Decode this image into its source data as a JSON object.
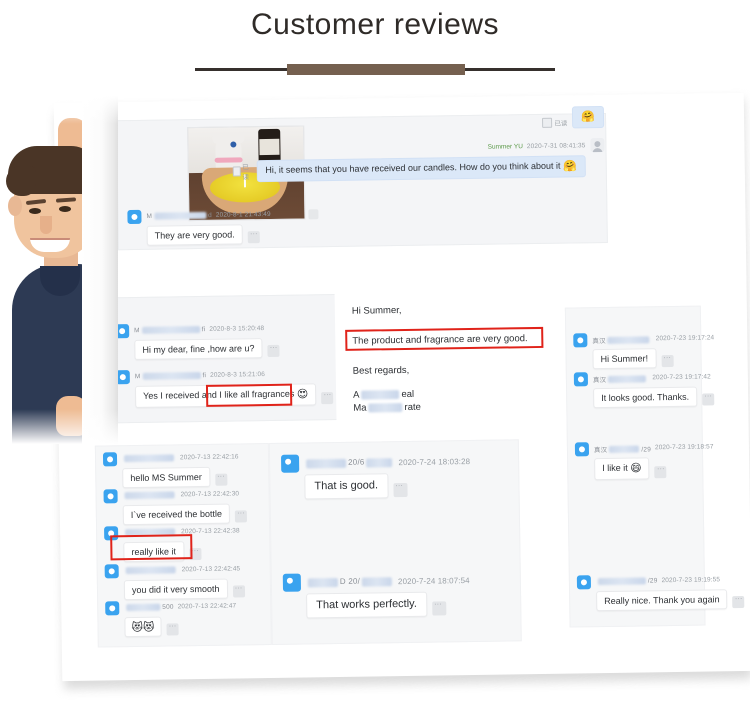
{
  "header": {
    "title": "Customer reviews",
    "rule_dark_color": "#36302d",
    "rule_brown_color": "#75604f"
  },
  "decor": {
    "man_photo_alt": "smiling man peeking around a white board",
    "card_background": "#ffffff",
    "panel_background": "#f4f5f7"
  },
  "panels": [
    {
      "id": "panel-top-left",
      "photo": {
        "alt": "yellow candle in a wooden bowl on a dark wood table"
      },
      "read_label": "已读",
      "messages": [
        {
          "side": "out",
          "nick": "Summer YU",
          "time": "2020-7-31 08:41:35",
          "text": "Hi, it seems that you have received our candles. How do you think about it",
          "emoji": "🤗",
          "read_label": "已读"
        },
        {
          "side": "in",
          "nick_prefix": "M",
          "nick_suffix": "d",
          "time": "2020-8-1 21:43:49",
          "text": "They are very good."
        }
      ]
    },
    {
      "id": "panel-mid-left",
      "messages": [
        {
          "side": "in",
          "nick_prefix": "M",
          "nick_suffix": "fi",
          "time": "2020-8-3 15:20:48",
          "text": "Hi my dear, fine ,how are u?"
        },
        {
          "side": "in",
          "nick_prefix": "M",
          "nick_suffix": "fi",
          "time": "2020-8-3 15:21:06",
          "text_before": "Yes I received and ",
          "text_highlight": "I like all fragrances",
          "emoji": "😍",
          "highlighted": true
        }
      ]
    },
    {
      "id": "panel-email",
      "lines": [
        "Hi Summer,",
        "The product and fragrance are very good.",
        "Best regards,",
        "A          eal",
        "Ma        rate"
      ],
      "highlight_line_index": 1
    },
    {
      "id": "panel-right-top",
      "messages": [
        {
          "side": "in",
          "nick_prefix": "真汉",
          "time": "2020-7-23 19:17:24",
          "text": "Hi Summer!"
        },
        {
          "side": "in",
          "nick_prefix": "真汉",
          "time": "2020-7-23 19:17:42",
          "text": "It looks good. Thanks."
        },
        {
          "side": "in",
          "nick_prefix": "真汉",
          "nick_suffix": "/29",
          "time": "2020-7-23 19:18:57",
          "text": "I like it ",
          "emoji": "😄"
        },
        {
          "side": "in",
          "nick_suffix": "/29",
          "time": "2020-7-23 19:19:55",
          "text": "Really nice. Thank you again"
        }
      ]
    },
    {
      "id": "panel-bottom-left",
      "messages": [
        {
          "side": "in",
          "time": "2020-7-13 22:42:16",
          "text": "hello MS Summer"
        },
        {
          "side": "in",
          "time": "2020-7-13 22:42:30",
          "text": "I`ve received the bottle"
        },
        {
          "side": "in",
          "time": "2020-7-13 22:42:38",
          "text": "really like it",
          "highlighted": true
        },
        {
          "side": "in",
          "time": "2020-7-13 22:42:45",
          "text": "you did it very smooth"
        },
        {
          "side": "in",
          "nick_suffix": "500",
          "time": "2020-7-13 22:42:47",
          "emoji": "😻😻"
        }
      ]
    },
    {
      "id": "panel-bottom-mid",
      "messages": [
        {
          "side": "in",
          "nick_suffix": "20/6",
          "time": "2020-7-24 18:03:28",
          "text": "That is good."
        },
        {
          "side": "in",
          "nick_suffix": "D 20/",
          "time": "2020-7-24 18:07:54",
          "text": "That works perfectly."
        }
      ]
    }
  ],
  "colors": {
    "highlight_red": "#e0231a",
    "avatar_blue": "#3aa3ef",
    "bubble_blue": "#dbe8f8"
  }
}
